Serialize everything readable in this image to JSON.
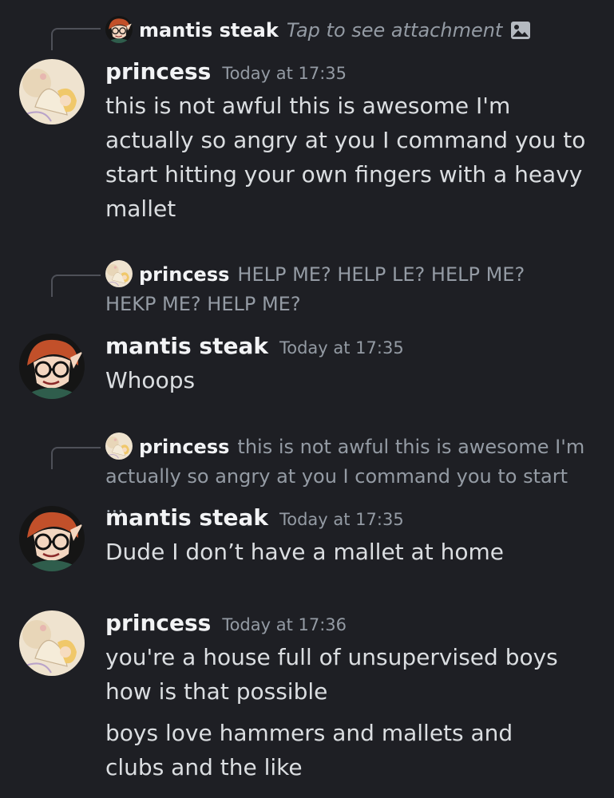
{
  "reply1": {
    "author": "mantis steak",
    "text": "Tap to see attachment",
    "icon": "image-icon"
  },
  "msg1": {
    "author": "princess",
    "timestamp": "Today at 17:35",
    "text": "this is not awful this is awesome I'm actually so angry at you I command you to start hitting your own fingers with a heavy mallet"
  },
  "reply2": {
    "author": "princess",
    "text": "HELP ME? HELP LE? HELP ME? HEKP ME? HELP ME?"
  },
  "msg2": {
    "author": "mantis steak",
    "timestamp": "Today at 17:35",
    "text": "Whoops"
  },
  "reply3": {
    "author": "princess",
    "text": "this is not awful this is awesome I'm actually so angry at you I command you to start ..."
  },
  "msg3": {
    "author": "mantis steak",
    "timestamp": "Today at 17:35",
    "text": "Dude I don’t have a mallet at home"
  },
  "msg4": {
    "author": "princess",
    "timestamp": "Today at 17:36",
    "text": "you're a house full of unsupervised boys how is that possible",
    "text2": "boys love hammers and mallets and clubs and the like"
  },
  "colors": {
    "background": "#1e1f24",
    "username": "#f2f3f5",
    "text": "#dbdee1",
    "muted": "#949ba4"
  }
}
